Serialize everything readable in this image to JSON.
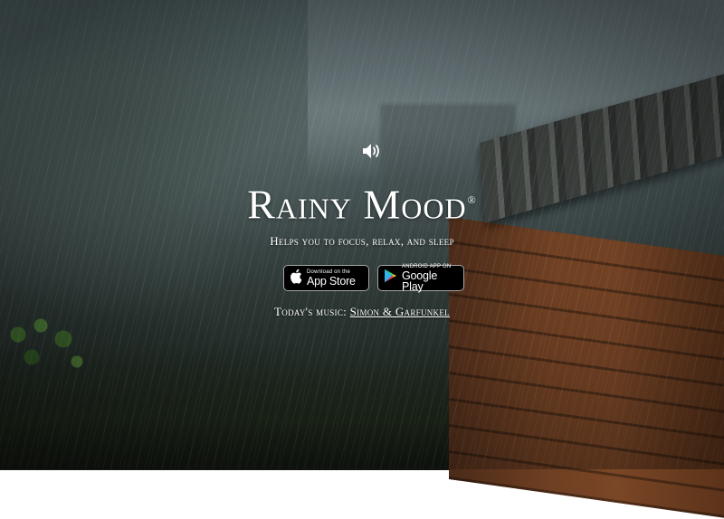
{
  "brand": {
    "title": "Rainy Mood",
    "registered_mark": "®",
    "tagline": "Helps you to focus, relax, and sleep"
  },
  "controls": {
    "sound_icon": "speaker-icon"
  },
  "stores": {
    "apple": {
      "small_label": "Download on the",
      "big_label": "App Store",
      "icon": "apple-icon"
    },
    "google": {
      "small_label": "ANDROID APP ON",
      "big_label": "Google Play",
      "icon": "google-play-icon"
    }
  },
  "music": {
    "prefix": "Today's music:",
    "link_label": "Simon & Garfunkel"
  },
  "colors": {
    "text": "#ffffff",
    "badge_bg": "#000000",
    "badge_border": "#a6a6a6"
  }
}
